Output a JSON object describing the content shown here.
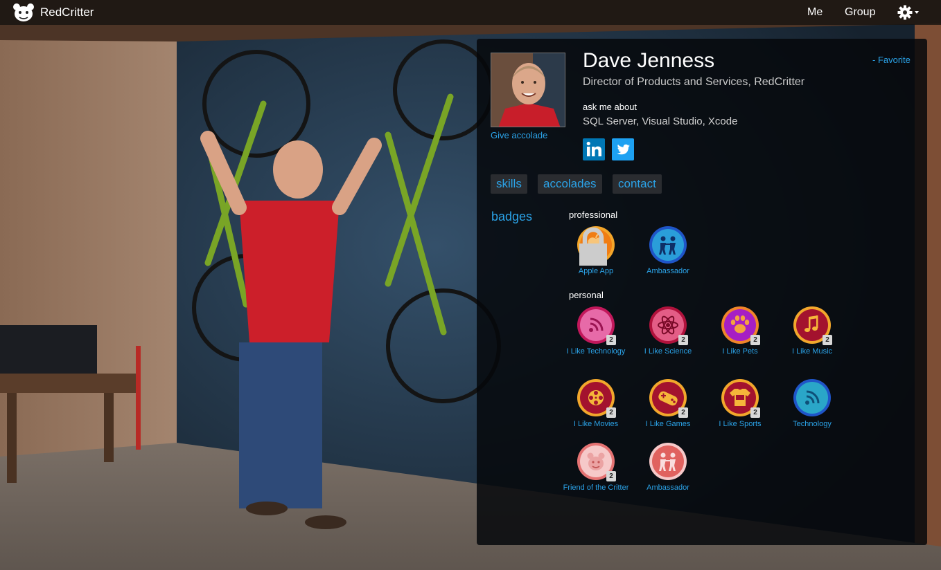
{
  "nav": {
    "brand": "RedCritter",
    "links": [
      "Me",
      "Group"
    ]
  },
  "profile": {
    "name": "Dave Jenness",
    "title": "Director of Products and Services, RedCritter",
    "ask_label": "ask me about",
    "ask_topics": "SQL Server, Visual Studio, Xcode",
    "give_accolade": "Give accolade",
    "favorite": "- Favorite"
  },
  "tabs": [
    "skills",
    "accolades",
    "contact"
  ],
  "badges": {
    "heading": "badges",
    "professional_label": "professional",
    "personal_label": "personal",
    "professional": [
      {
        "label": "Apple App",
        "icon": "apple-icon",
        "locked": true
      },
      {
        "label": "Ambassador",
        "icon": "ambassador-icon"
      }
    ],
    "personal": [
      {
        "label": "I Like Technology",
        "icon": "wireless-icon",
        "count": "2"
      },
      {
        "label": "I Like Science",
        "icon": "atom-icon",
        "count": "2"
      },
      {
        "label": "I Like Pets",
        "icon": "paw-icon",
        "count": "2"
      },
      {
        "label": "I Like Music",
        "icon": "music-note-icon",
        "count": "2"
      },
      {
        "label": "I Like Movies",
        "icon": "film-reel-icon",
        "count": "2"
      },
      {
        "label": "I Like Games",
        "icon": "gamepad-icon",
        "count": "2"
      },
      {
        "label": "I Like Sports",
        "icon": "jersey-icon",
        "count": "2"
      },
      {
        "label": "Technology",
        "icon": "wireless-icon"
      },
      {
        "label": "Friend of the Critter",
        "icon": "critter-icon",
        "count": "2"
      },
      {
        "label": "Ambassador",
        "icon": "ambassador-icon"
      }
    ]
  },
  "colors": {
    "link": "#2ba3e8",
    "linkedin": "#0077b5",
    "twitter": "#1da1f2"
  }
}
